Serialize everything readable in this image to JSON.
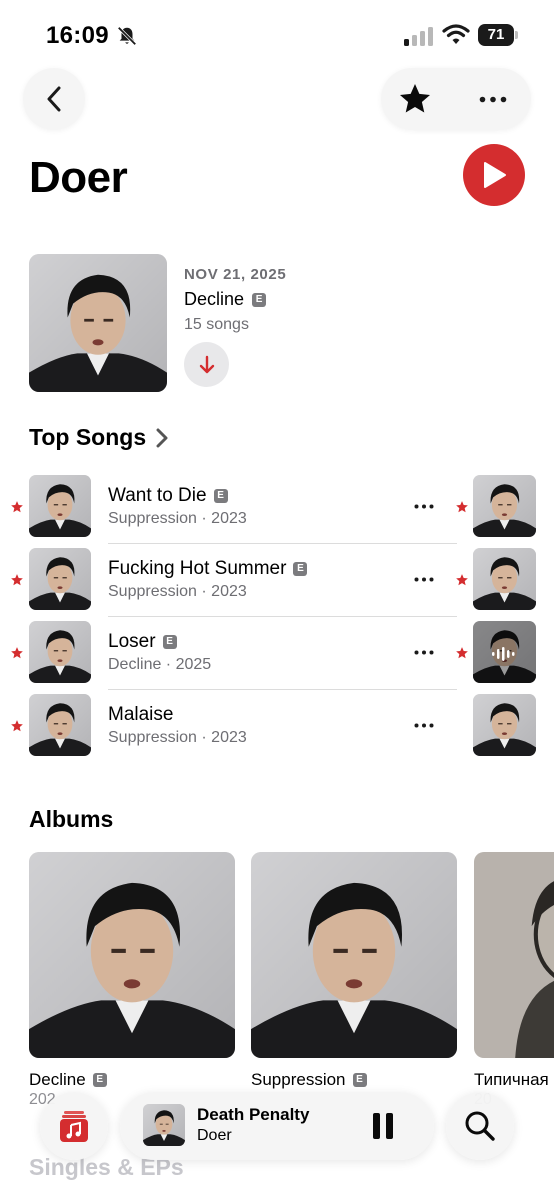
{
  "status_bar": {
    "time": "16:09",
    "battery": "71",
    "icons": [
      "bell-slash-icon",
      "signal-icon",
      "wifi-icon",
      "battery-icon"
    ]
  },
  "nav": {
    "back_icon": "chevron-left-icon",
    "favorite_icon": "star-icon",
    "more_icon": "ellipsis-icon"
  },
  "artist": {
    "name": "Doer",
    "play_icon": "play-icon"
  },
  "latest_release": {
    "date": "NOV 21, 2025",
    "title": "Decline",
    "explicit": "E",
    "song_count": "15 songs",
    "download_icon": "arrow-down-icon"
  },
  "top_songs": {
    "heading": "Top Songs",
    "songs": [
      {
        "title": "Want to Die",
        "explicit": "E",
        "subtitle": "Suppression · 2023",
        "favorited": true
      },
      {
        "title": "Fucking Hot Summer",
        "explicit": "E",
        "subtitle": "Suppression · 2023",
        "favorited": true
      },
      {
        "title": "Loser",
        "explicit": "E",
        "subtitle": "Decline · 2025",
        "favorited": true
      },
      {
        "title": "Malaise",
        "explicit": "",
        "subtitle": "Suppression · 2023",
        "favorited": true
      }
    ]
  },
  "albums": {
    "heading": "Albums",
    "items": [
      {
        "title": "Decline",
        "explicit": "E",
        "year": "202"
      },
      {
        "title": "Suppression",
        "explicit": "E",
        "year": ""
      },
      {
        "title": "Типичная",
        "explicit": "",
        "year": "20"
      }
    ]
  },
  "singles": {
    "heading": "Singles & EPs"
  },
  "now_playing": {
    "title": "Death Penalty",
    "artist": "Doer",
    "library_icon": "music-note-icon",
    "pause_icon": "pause-icon",
    "search_icon": "search-icon"
  },
  "colors": {
    "accent": "#d42d2f",
    "secondary_text": "#6e6e73",
    "explicit_badge": "#7b7b7e"
  }
}
